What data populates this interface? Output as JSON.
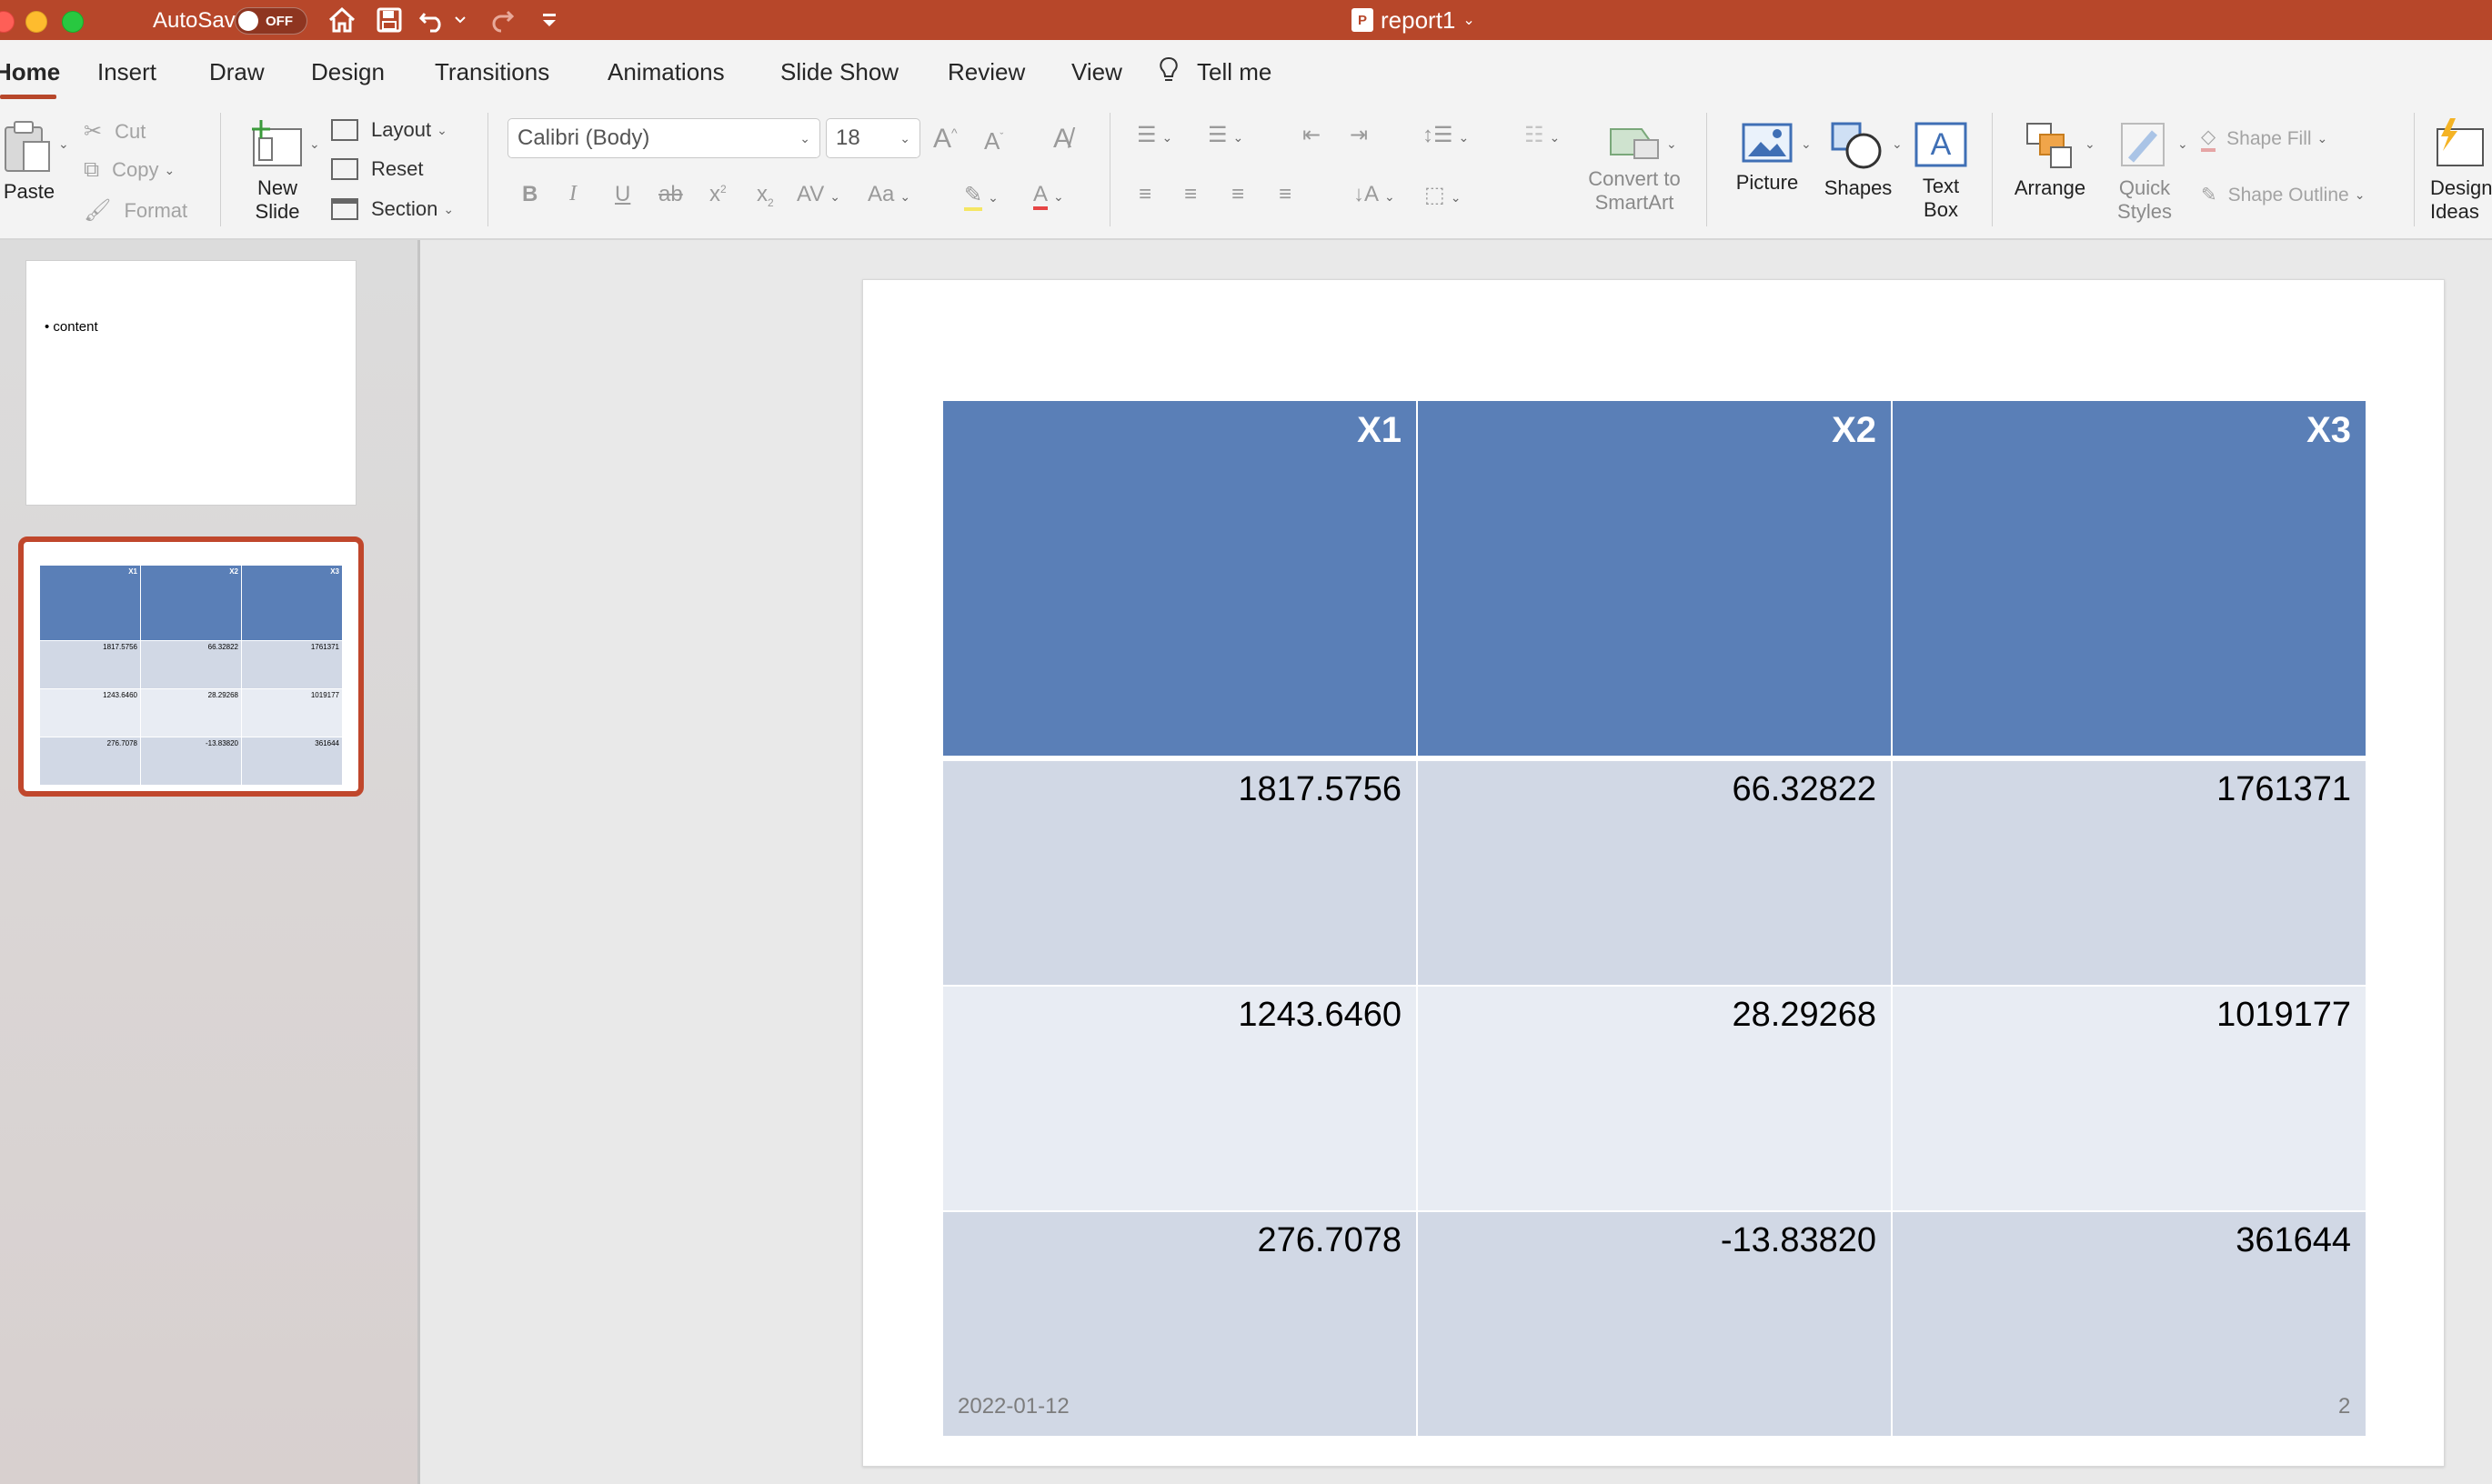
{
  "titlebar": {
    "autosave_label": "AutoSave",
    "autosave_state": "OFF",
    "doc_title": "report1",
    "app_badge": "P",
    "bg_color": "#b7472a"
  },
  "tabs": [
    {
      "label": "Home",
      "active": true
    },
    {
      "label": "Insert"
    },
    {
      "label": "Draw"
    },
    {
      "label": "Design"
    },
    {
      "label": "Transitions"
    },
    {
      "label": "Animations"
    },
    {
      "label": "Slide Show"
    },
    {
      "label": "Review"
    },
    {
      "label": "View"
    },
    {
      "label": "Tell me"
    }
  ],
  "ribbon": {
    "paste": "Paste",
    "cut": "Cut",
    "copy": "Copy",
    "format": "Format",
    "new_slide_1": "New",
    "new_slide_2": "Slide",
    "layout": "Layout",
    "reset": "Reset",
    "section": "Section",
    "font_name": "Calibri (Body)",
    "font_size": "18",
    "convert_1": "Convert to",
    "convert_2": "SmartArt",
    "picture": "Picture",
    "shapes": "Shapes",
    "textbox_1": "Text",
    "textbox_2": "Box",
    "arrange": "Arrange",
    "quick_styles_1": "Quick",
    "quick_styles_2": "Styles",
    "shape_fill": "Shape Fill",
    "shape_outline": "Shape Outline",
    "design_ideas_1": "Design",
    "design_ideas_2": "Ideas"
  },
  "thumbnails": {
    "slide1_text": "content",
    "slide2": {
      "headers": [
        "X1",
        "X2",
        "X3"
      ],
      "rows": [
        [
          "1817.5756",
          "66.32822",
          "1761371"
        ],
        [
          "1243.6460",
          "28.29268",
          "1019177"
        ],
        [
          "276.7078",
          "-13.83820",
          "361644"
        ]
      ]
    }
  },
  "slide": {
    "table": {
      "headers": [
        "X1",
        "X2",
        "X3"
      ],
      "rows": [
        [
          "1817.5756",
          "66.32822",
          "1761371"
        ],
        [
          "1243.6460",
          "28.29268",
          "1019177"
        ],
        [
          "276.7078",
          "-13.83820",
          "361644"
        ]
      ],
      "header_color": "#5a7fb7",
      "band_color_1": "#d1d8e5",
      "band_color_2": "#e8ecf3"
    },
    "footer_date": "2022-01-12",
    "slide_number": "2"
  }
}
